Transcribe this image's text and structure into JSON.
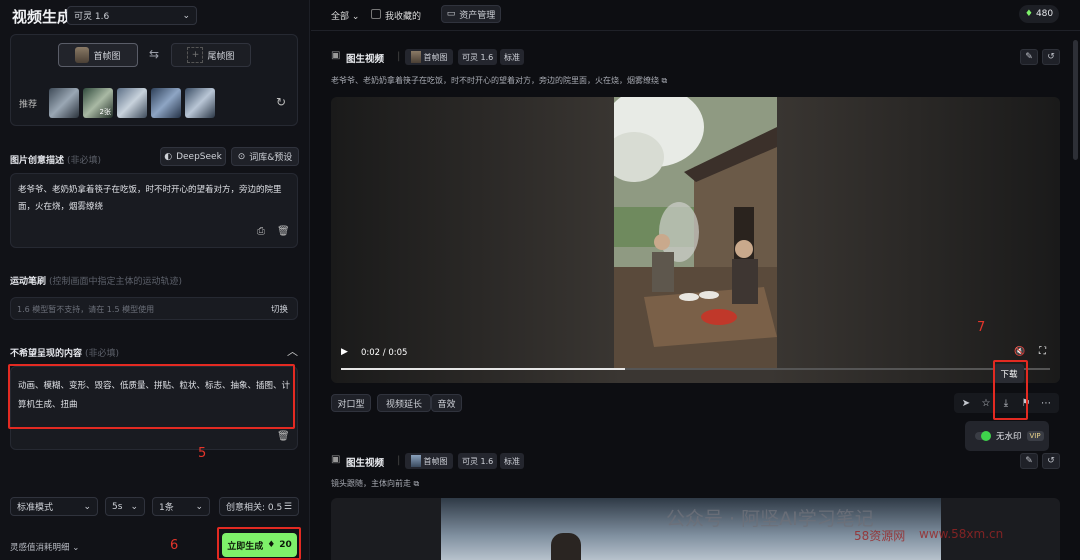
{
  "sidebar": {
    "title": "视频生成",
    "model_select": "可灵 1.6",
    "frames": {
      "first": "首帧图",
      "last": "尾帧图"
    },
    "recommend_label": "推荐",
    "recommend_badge": "2张",
    "prompt_section": {
      "title": "图片创意描述",
      "hint": "(非必填)",
      "deepseek_btn": "DeepSeek",
      "lib_btn": "词库&预设",
      "text": "老爷爷、老奶奶拿着筷子在吃饭，时不时开心的望着对方，旁边的院里面，火在烧，烟雾缭绕"
    },
    "motion_section": {
      "title": "运动笔刷",
      "hint": "(控制画面中指定主体的运动轨迹)",
      "placeholder": "1.6 模型暂不支持，请在 1.5 模型使用",
      "switch_btn": "切换"
    },
    "negative_section": {
      "title": "不希望呈现的内容",
      "hint": "(非必填)",
      "text": "动画、模糊、变形、毁容、低质量、拼贴、粒状、标志、抽象、插图、计算机生成、扭曲"
    },
    "settings": {
      "mode": "标准模式",
      "duration": "5s",
      "count": "1条",
      "relevance_label": "创意相关: 0.5"
    },
    "footer": {
      "consume_label": "灵感值消耗明细",
      "generate_label": "立即生成",
      "generate_cost": "20"
    }
  },
  "topbar": {
    "filter": "全部",
    "favorites": "我收藏的",
    "assets": "资产管理",
    "credits": "480"
  },
  "cards": [
    {
      "title": "图生视频",
      "chip_first": "首帧图",
      "chip_model": "可灵 1.6",
      "chip_mode": "标准",
      "prompt": "老爷爷、老奶奶拿着筷子在吃饭，时不时开心的望着对方，旁边的院里面，火在烧，烟雾缭绕"
    },
    {
      "title": "图生视频",
      "chip_first": "首帧图",
      "chip_model": "可灵 1.6",
      "chip_mode": "标准",
      "prompt": "镜头跟随，主体向前走"
    }
  ],
  "player": {
    "time": "0:02 / 0:05",
    "progress": 0.4
  },
  "actions": {
    "lipsync": "对口型",
    "extend": "视频延长",
    "sound": "音效"
  },
  "download_tooltip": "下载",
  "watermark_toggle": {
    "label": "无水印",
    "badge": "VIP"
  },
  "annotations": {
    "n5": "5",
    "n6": "6",
    "n7": "7"
  },
  "overlay_watermark": {
    "text": "公众号 · 阿坚AI学习笔记",
    "site1": "58资源网",
    "site2": "www.58xm.cn"
  },
  "colors": {
    "accent_green": "#7ef16a",
    "annotation_red": "#e32a22"
  }
}
